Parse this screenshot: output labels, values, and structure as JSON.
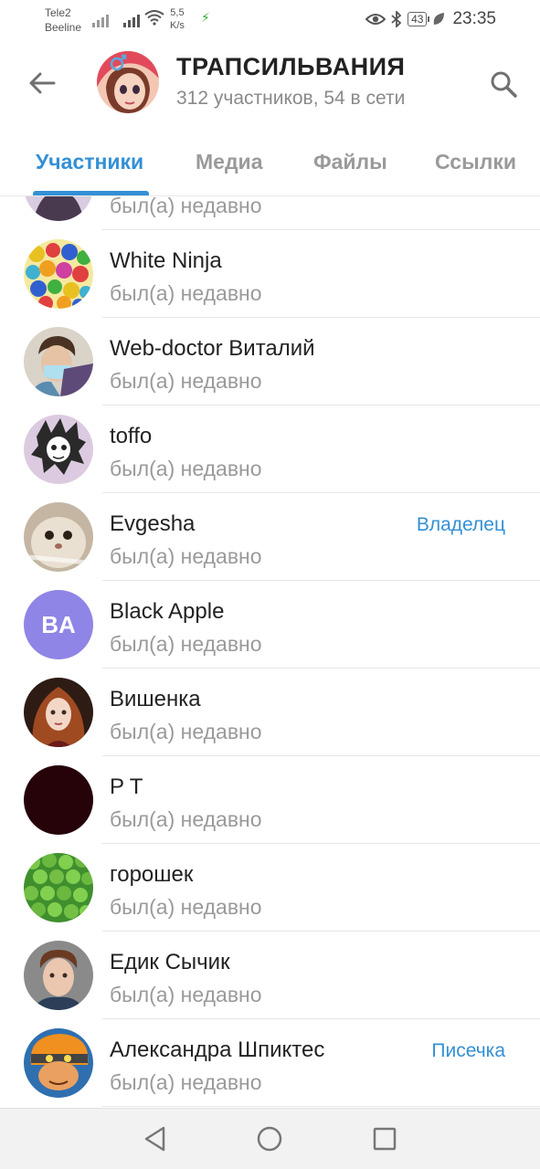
{
  "status_bar": {
    "carrier1": "Tele2",
    "carrier2": "Beeline",
    "speed_value": "5,5",
    "speed_unit": "K/s",
    "battery": "43",
    "time": "23:35",
    "icons": [
      "signal-icon",
      "wifi-icon",
      "charging-icon",
      "eye-icon",
      "bluetooth-icon",
      "battery-icon",
      "leaf-icon"
    ]
  },
  "header": {
    "title": "ТРАПСИЛЬВАНИЯ",
    "subtitle": "312 участников, 54 в сети",
    "back_icon": "arrow-left-icon",
    "search_icon": "search-icon"
  },
  "tabs": [
    {
      "label": "Участники",
      "active": true
    },
    {
      "label": "Медиа",
      "active": false
    },
    {
      "label": "Файлы",
      "active": false
    },
    {
      "label": "Ссылки",
      "active": false
    }
  ],
  "members": [
    {
      "name": "",
      "status": "был(а) недавно",
      "role": "",
      "avatar": "photo"
    },
    {
      "name": "White Ninja",
      "status": "был(а) недавно",
      "role": "",
      "avatar": "photo"
    },
    {
      "name": "Web-doctor Виталий",
      "status": "был(а) недавно",
      "role": "",
      "avatar": "photo"
    },
    {
      "name": "toffo",
      "status": "был(а) недавно",
      "role": "",
      "avatar": "photo"
    },
    {
      "name": "Evgesha",
      "status": "был(а) недавно",
      "role": "Владелец",
      "avatar": "photo"
    },
    {
      "name": "Black Apple",
      "status": "был(а) недавно",
      "role": "",
      "avatar": "initials",
      "initials": "BA"
    },
    {
      "name": "Вишенка",
      "status": "был(а) недавно",
      "role": "",
      "avatar": "photo"
    },
    {
      "name": "P T",
      "status": "был(а) недавно",
      "role": "",
      "avatar": "photo"
    },
    {
      "name": "горошек",
      "status": "был(а) недавно",
      "role": "",
      "avatar": "photo"
    },
    {
      "name": "Едик Сычик",
      "status": "был(а) недавно",
      "role": "",
      "avatar": "photo"
    },
    {
      "name": "Александра Шпиктес",
      "status": "был(а) недавно",
      "role": "Писечка",
      "avatar": "photo"
    }
  ],
  "colors": {
    "accent": "#3390d5",
    "secondary_text": "#9a9a9a",
    "initials_avatar": "#8e85e6"
  },
  "nav_bar": {
    "icons": [
      "back-triangle-icon",
      "home-circle-icon",
      "recents-square-icon"
    ]
  }
}
